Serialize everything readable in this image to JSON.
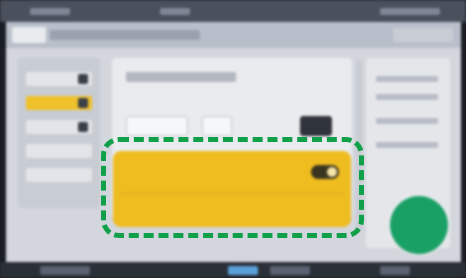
{
  "colors": {
    "highlight_yellow": "#efbd20",
    "annotation_green": "#10a04a",
    "action_button_green": "#19a065",
    "dark_chrome": "#2a2e36"
  },
  "icons": {
    "toggle": "toggle-switch-icon",
    "action": "circle-action-icon"
  },
  "highlight_card": {
    "row1_left": "",
    "row1_mid": "",
    "row2_left": "",
    "row2_right": ""
  },
  "action_button": {
    "label": ""
  }
}
